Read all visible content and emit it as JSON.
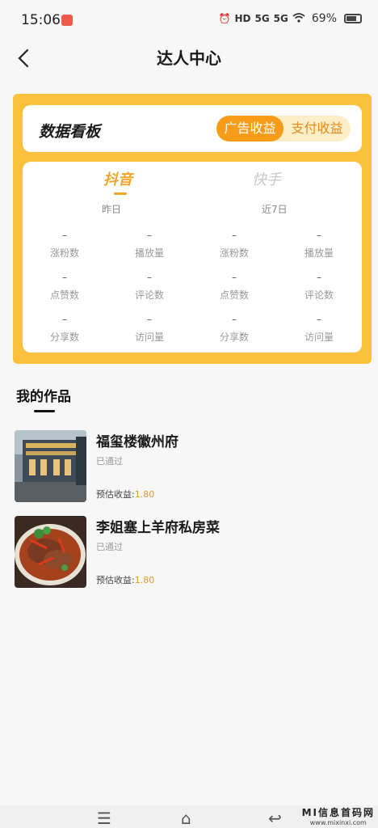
{
  "status_bar": {
    "time": "15:06",
    "hd": "HD",
    "signal1": "5G",
    "signal2": "5G",
    "battery": "69%"
  },
  "nav": {
    "title": "达人中心",
    "back_icon": "chevron-left-icon"
  },
  "dashboard": {
    "title": "数据看板",
    "tabs": [
      "广告收益",
      "支付收益"
    ],
    "active_tab": "广告收益",
    "platforms": [
      "抖音",
      "快手"
    ],
    "active_platform": "抖音",
    "periods": [
      "昨日",
      "近7日"
    ],
    "metrics": [
      [
        {
          "value": "–",
          "label": "涨粉数"
        },
        {
          "value": "–",
          "label": "播放量"
        },
        {
          "value": "–",
          "label": "涨粉数"
        },
        {
          "value": "–",
          "label": "播放量"
        }
      ],
      [
        {
          "value": "–",
          "label": "点赞数"
        },
        {
          "value": "–",
          "label": "评论数"
        },
        {
          "value": "–",
          "label": "点赞数"
        },
        {
          "value": "–",
          "label": "评论数"
        }
      ],
      [
        {
          "value": "–",
          "label": "分享数"
        },
        {
          "value": "–",
          "label": "访问量"
        },
        {
          "value": "–",
          "label": "分享数"
        },
        {
          "value": "–",
          "label": "访问量"
        }
      ]
    ],
    "accent": "#fcc13c",
    "active_color": "#f69c19"
  },
  "works": {
    "title": "我的作品",
    "items": [
      {
        "title": "福玺楼徽州府",
        "status": "已通过",
        "earn_label": "预估收益:",
        "earn_value": "1.80"
      },
      {
        "title": "李姐塞上羊府私房菜",
        "status": "已通过",
        "earn_label": "预估收益:",
        "earn_value": "1.80"
      }
    ]
  },
  "watermark": {
    "line1": "MI信息首码网",
    "line2": "www.mixinxi.com"
  }
}
